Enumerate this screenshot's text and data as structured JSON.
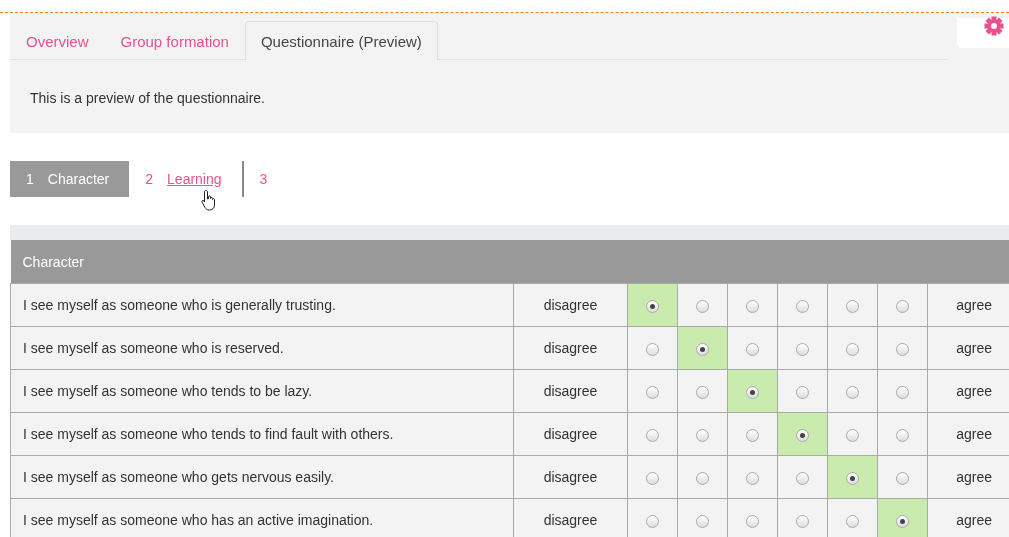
{
  "tabs": [
    {
      "label": "Overview",
      "selected": false
    },
    {
      "label": "Group formation",
      "selected": false
    },
    {
      "label": "Questionnaire (Preview)",
      "selected": true
    }
  ],
  "intro": "This is a preview of the questionnaire.",
  "steps": [
    {
      "number": "1",
      "label": "Character",
      "selected": true
    },
    {
      "number": "2",
      "label": "Learning",
      "selected": false
    },
    {
      "number": "3",
      "selected": false
    }
  ],
  "table": {
    "title": "Character",
    "rows": [
      {
        "question": "I see myself as someone who is generally trusting.",
        "low": "disagree",
        "high": "agree",
        "options": [
          {
            "selected": true
          },
          {
            "selected": false
          },
          {
            "selected": false
          },
          {
            "selected": false
          },
          {
            "selected": false
          },
          {
            "selected": false
          }
        ]
      },
      {
        "question": "I see myself as someone who is reserved.",
        "low": "disagree",
        "high": "agree",
        "options": [
          {
            "selected": false
          },
          {
            "selected": true
          },
          {
            "selected": false
          },
          {
            "selected": false
          },
          {
            "selected": false
          },
          {
            "selected": false
          }
        ]
      },
      {
        "question": "I see myself as someone who tends to be lazy.",
        "low": "disagree",
        "high": "agree",
        "options": [
          {
            "selected": false
          },
          {
            "selected": false
          },
          {
            "selected": true
          },
          {
            "selected": false
          },
          {
            "selected": false
          },
          {
            "selected": false
          }
        ]
      },
      {
        "question": "I see myself as someone who tends to find fault with others.",
        "low": "disagree",
        "high": "agree",
        "options": [
          {
            "selected": false
          },
          {
            "selected": false
          },
          {
            "selected": false
          },
          {
            "selected": true
          },
          {
            "selected": false
          },
          {
            "selected": false
          }
        ]
      },
      {
        "question": "I see myself as someone who gets nervous easily.",
        "low": "disagree",
        "high": "agree",
        "options": [
          {
            "selected": false
          },
          {
            "selected": false
          },
          {
            "selected": false
          },
          {
            "selected": false
          },
          {
            "selected": true
          },
          {
            "selected": false
          }
        ]
      },
      {
        "question": "I see myself as someone who has an active imagination.",
        "low": "disagree",
        "high": "agree",
        "options": [
          {
            "selected": false
          },
          {
            "selected": false
          },
          {
            "selected": false
          },
          {
            "selected": false
          },
          {
            "selected": false
          },
          {
            "selected": true
          }
        ]
      }
    ]
  }
}
